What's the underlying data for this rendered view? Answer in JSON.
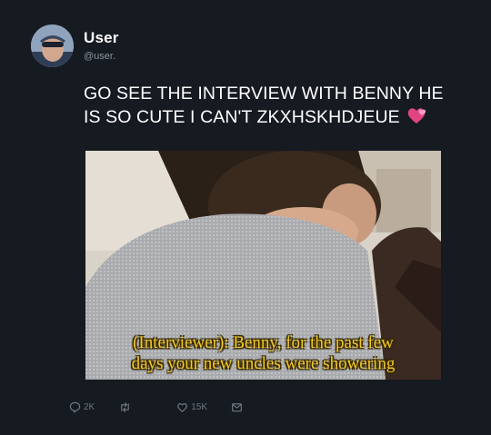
{
  "author": {
    "name": "User",
    "handle": "@user."
  },
  "tweet": {
    "text": "GO SEE THE INTERVIEW WITH BENNY HE IS SO CUTE I CAN'T ZKXHSKHDJEUE",
    "emoji": "two-hearts-icon"
  },
  "media": {
    "caption_line1": "(Interviewer): Benny, for the past few",
    "caption_line2": "days your new uncles were showering"
  },
  "actions": {
    "reply_count": "2K",
    "like_count": "15K"
  },
  "colors": {
    "background": "#161a21",
    "text": "#ffffff",
    "muted": "#8b949e",
    "action_icon": "#6e7681",
    "caption": "#f2c72c"
  }
}
